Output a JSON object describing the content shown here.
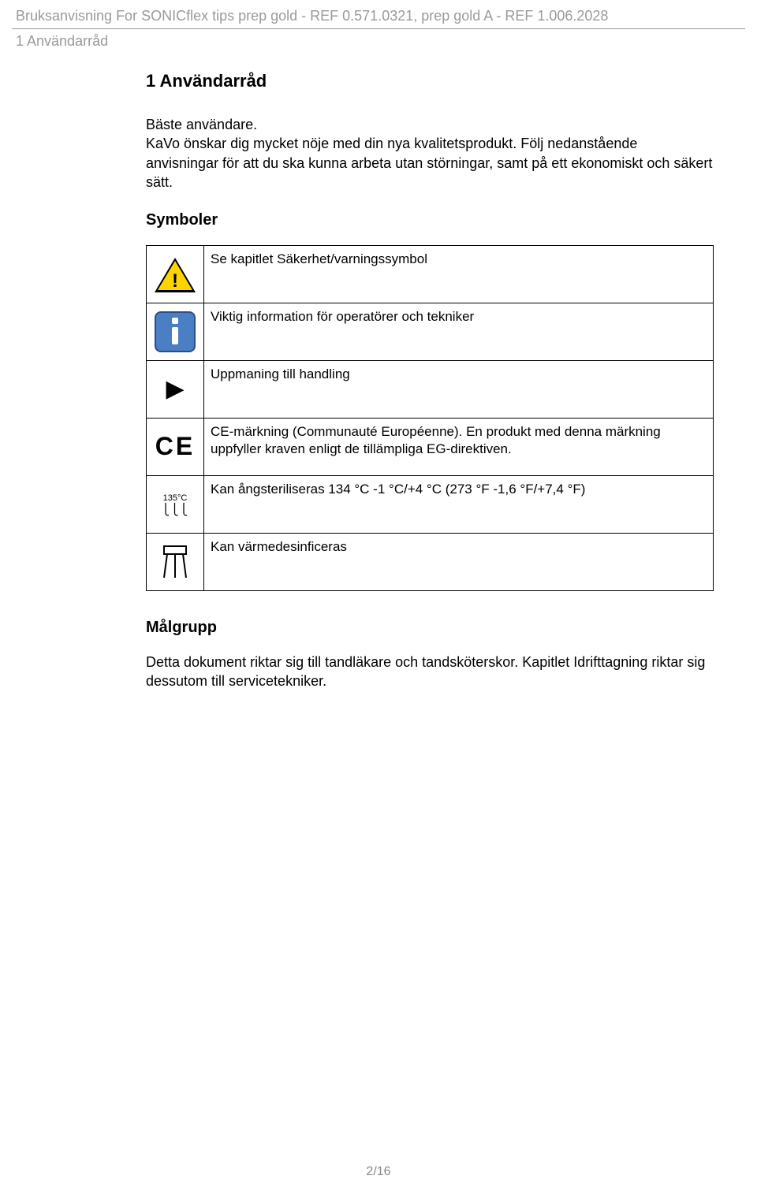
{
  "header": {
    "title": "Bruksanvisning For SONICflex tips prep gold - REF 0.571.0321, prep gold A - REF 1.006.2028",
    "subtitle": "1 Användarråd"
  },
  "section": {
    "heading": "1   Användarråd",
    "intro_line1": "Bäste användare.",
    "intro_rest": "KaVo önskar dig mycket nöje med din nya kvalitetsprodukt. Följ nedanstående anvisningar för att du ska kunna arbeta utan störningar, samt på ett ekonomiskt och säkert sätt.",
    "symbols_heading": "Symboler",
    "symbols": [
      {
        "icon": "warning-icon",
        "text": "Se kapitlet Säkerhet/varningssymbol"
      },
      {
        "icon": "info-icon",
        "text": "Viktig information för operatörer och tekniker"
      },
      {
        "icon": "action-icon",
        "text": "Uppmaning till handling"
      },
      {
        "icon": "ce-icon",
        "text": "CE-märkning (Communauté Européenne). En produkt med denna märkning uppfyller kraven enligt de tillämpliga EG-direktiven."
      },
      {
        "icon": "sterilize-icon",
        "text": "Kan ångsteriliseras 134 °C -1 °C/+4 °C (273 °F -1,6 °F/+7,4 °F)"
      },
      {
        "icon": "thermo-icon",
        "text": "Kan värmedesinficeras"
      }
    ],
    "sterilize_label": "135°C",
    "target_heading": "Målgrupp",
    "target_text": "Detta dokument riktar sig till tandläkare och tandsköterskor. Kapitlet Idrifttagning riktar sig dessutom till servicetekniker."
  },
  "footer": {
    "page": "2/16"
  }
}
